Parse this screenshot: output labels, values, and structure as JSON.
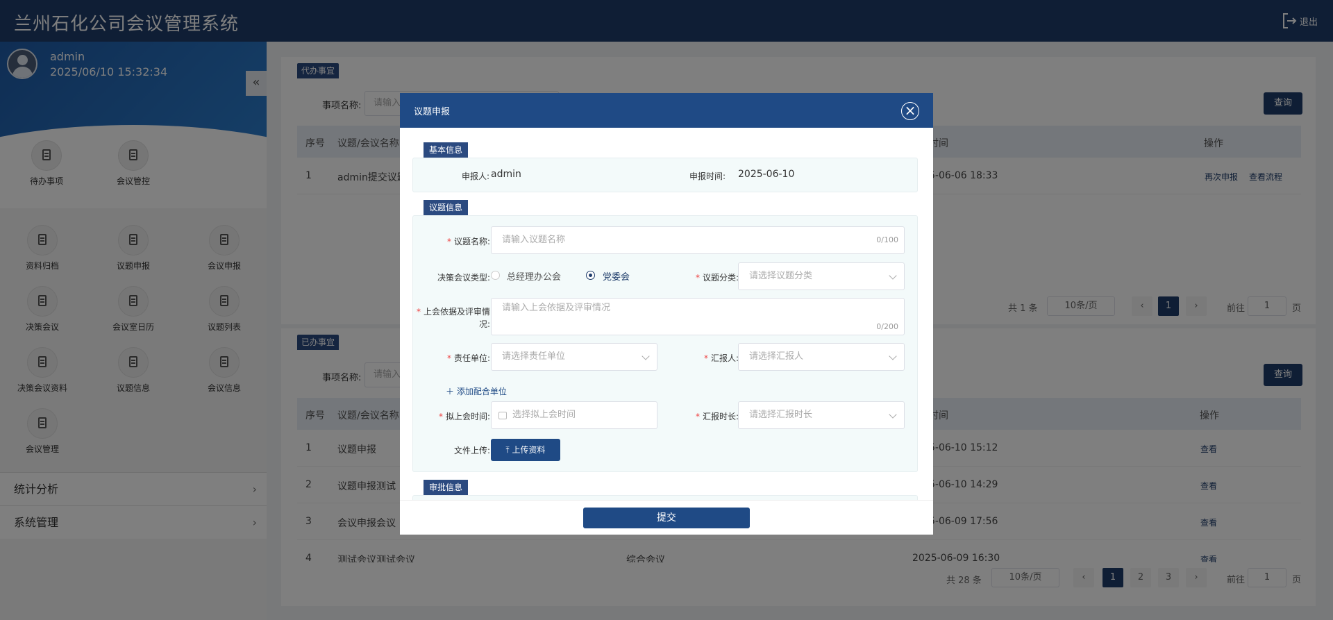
{
  "app": {
    "title": "兰州石化公司会议管理系统",
    "logout": "退出"
  },
  "user": {
    "name": "admin",
    "datetime": "2025/06/10 15:32:34"
  },
  "quick": [
    "待办事项",
    "会议管控"
  ],
  "nav_icons": [
    "资料归档",
    "议题申报",
    "会议申报",
    "决策会议",
    "会议室日历",
    "议题列表",
    "决策会议资料",
    "议题信息",
    "会议信息",
    "会议管理"
  ],
  "menus": [
    {
      "label": "统计分析"
    },
    {
      "label": "系统管理"
    }
  ],
  "todo": {
    "tag": "代办事宜",
    "filter_label": "事项名称:",
    "filter_placeholder": "请输入",
    "query": "查询",
    "headers": {
      "no": "序号",
      "name": "议题/会议名称",
      "time": "时间",
      "ops": "操作"
    },
    "rows": [
      {
        "no": "1",
        "name": "admin提交议题",
        "time": "5-06-06 18:33",
        "op1": "再次申报",
        "op2": "查看流程"
      }
    ],
    "total": "共 1 条",
    "page_size": "10条/页",
    "page": "1",
    "goto": "前往",
    "goto_val": "1",
    "page_unit": "页"
  },
  "done": {
    "tag": "已办事宜",
    "filter_label": "事项名称:",
    "filter_placeholder": "请输入",
    "query": "查询",
    "headers": {
      "no": "序号",
      "name": "议题/会议名称",
      "time": "时间",
      "ops": "操作"
    },
    "rows": [
      {
        "no": "1",
        "name": "议题申报",
        "mid": "",
        "time": "5-06-10 15:12",
        "op": "查看"
      },
      {
        "no": "2",
        "name": "议题申报测试",
        "mid": "",
        "time": "5-06-10 14:29",
        "op": "查看"
      },
      {
        "no": "3",
        "name": "会议申报会议",
        "mid": "",
        "time": "5-06-09 17:56",
        "op": "查看"
      },
      {
        "no": "4",
        "name": "测试会议测试会议",
        "mid": "综合会议",
        "time": "2025-06-09 16:30",
        "op": "查看"
      }
    ],
    "total": "共 28 条",
    "page_size": "10条/页",
    "pages": [
      "1",
      "2",
      "3"
    ],
    "goto": "前往",
    "goto_val": "1",
    "page_unit": "页"
  },
  "modal": {
    "title": "议题申报",
    "basic_tag": "基本信息",
    "reporter_label": "申报人:",
    "reporter": "admin",
    "report_time_label": "申报时间:",
    "report_time": "2025-06-10",
    "topic_tag": "议题信息",
    "topic_name_label": "议题名称:",
    "topic_name_ph": "请输入议题名称",
    "topic_name_count": "0/100",
    "meeting_type_label": "决策会议类型:",
    "opt1": "总经理办公会",
    "opt2": "党委会",
    "category_label": "议题分类:",
    "category_ph": "请选择议题分类",
    "basis_label": "上会依据及评审情况:",
    "basis_ph": "请输入上会依据及评审情况",
    "basis_count": "0/200",
    "unit_label": "责任单位:",
    "unit_ph": "请选择责任单位",
    "reporter2_label": "汇报人:",
    "reporter2_ph": "请选择汇报人",
    "add_unit": "添加配合单位",
    "plan_time_label": "拟上会时间:",
    "plan_time_ph": "选择拟上会时间",
    "duration_label": "汇报时长:",
    "duration_ph": "请选择汇报时长",
    "upload_label": "文件上传:",
    "upload_btn": "上传资料",
    "approve_tag": "审批信息",
    "submit": "提交"
  }
}
